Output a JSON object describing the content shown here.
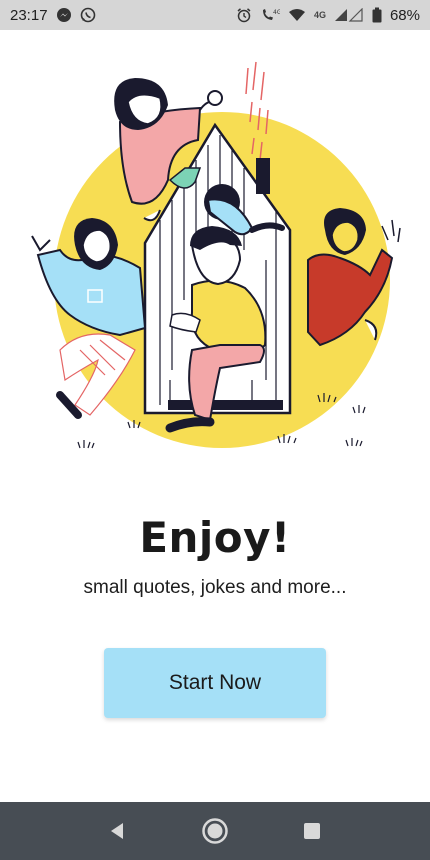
{
  "status_bar": {
    "time": "23:17",
    "network_label": "4G",
    "battery": "68%"
  },
  "main": {
    "title": "Enjoy!",
    "subtitle": "small quotes, jokes and more...",
    "start_button": "Start Now"
  },
  "colors": {
    "accent_button": "#a5e0f7",
    "illustration_circle": "#f7dd53",
    "nav_bar": "#474d54"
  },
  "icons": {
    "status_left": [
      "messenger-icon",
      "whatsapp-icon"
    ],
    "status_right": [
      "alarm-icon",
      "call-icon",
      "wifi-icon",
      "signal-icon",
      "battery-icon"
    ],
    "nav": [
      "back-icon",
      "home-icon",
      "recents-icon"
    ]
  }
}
